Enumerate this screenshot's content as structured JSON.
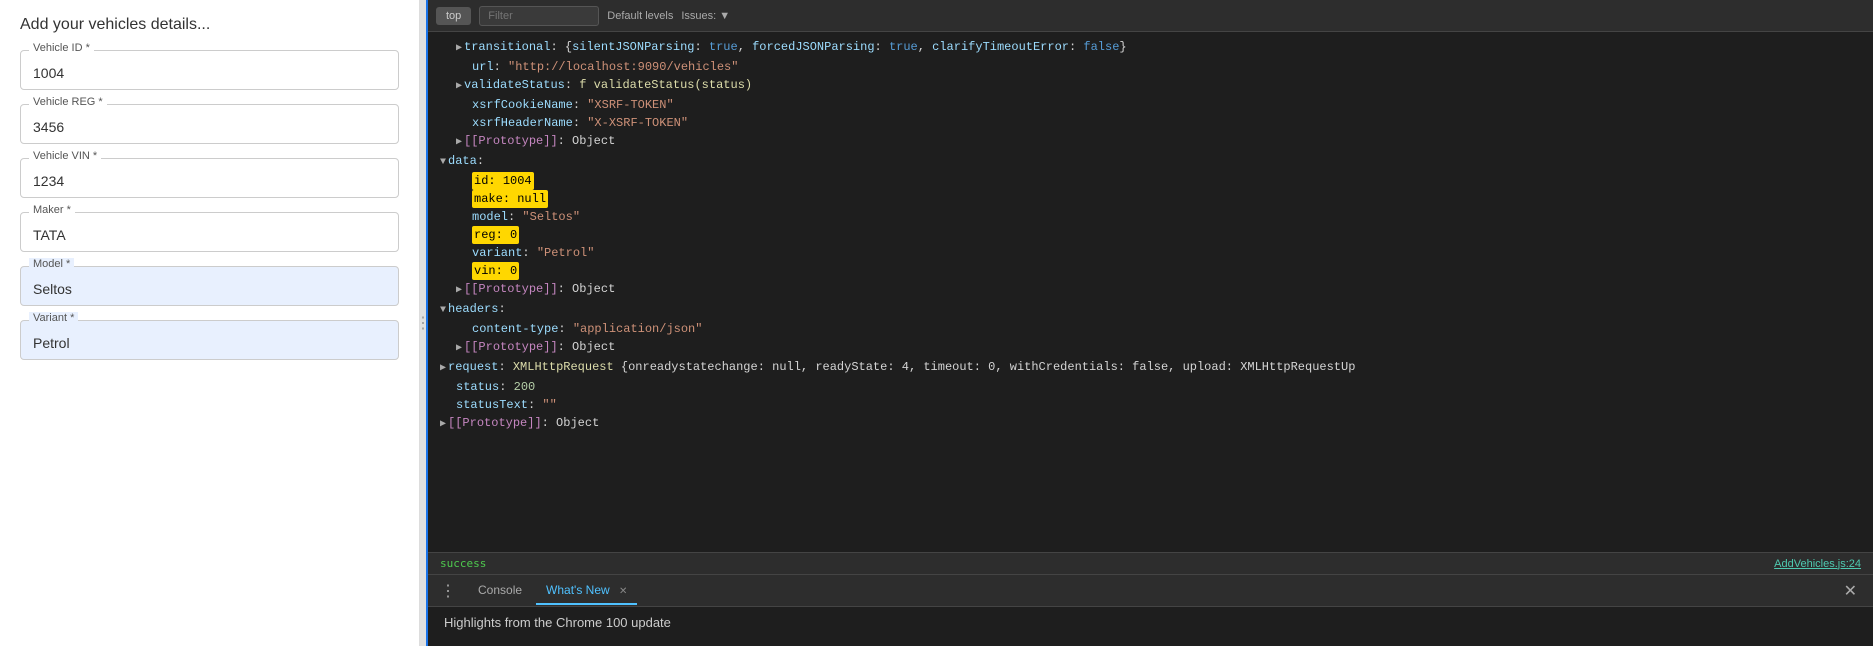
{
  "form": {
    "title": "Add your vehicles details...",
    "fields": [
      {
        "id": "vehicle-id",
        "label": "Vehicle ID",
        "required": true,
        "value": "1004"
      },
      {
        "id": "vehicle-reg",
        "label": "Vehicle REG",
        "required": true,
        "value": "3456"
      },
      {
        "id": "vehicle-vin",
        "label": "Vehicle VIN",
        "required": true,
        "value": "1234"
      },
      {
        "id": "maker",
        "label": "Maker",
        "required": true,
        "value": "TATA"
      },
      {
        "id": "model",
        "label": "Model",
        "required": true,
        "value": "Seltos",
        "highlighted": true
      },
      {
        "id": "variant",
        "label": "Variant",
        "required": true,
        "value": "Petrol",
        "highlighted": true
      }
    ]
  },
  "devtools": {
    "toolbar": {
      "top_btn": "top",
      "filter_placeholder": "Filter",
      "level_label": "Default levels",
      "issues_label": "Issues: ▼"
    },
    "code_lines": [
      {
        "indent": 1,
        "content": "transitional: {silentJSONParsing: true, forcedJSONParsing: true, clarifyTimeoutError: false}"
      },
      {
        "indent": 1,
        "content": "url: \"http://localhost:9090/vehicles\""
      },
      {
        "indent": 1,
        "content": "validateStatus: f validateStatus(status)"
      },
      {
        "indent": 1,
        "content": "xsrfCookieName: \"XSRF-TOKEN\""
      },
      {
        "indent": 1,
        "content": "xsrfHeaderName: \"X-XSRF-TOKEN\""
      },
      {
        "indent": 1,
        "content": "[[Prototype]]: Object"
      },
      {
        "indent": 0,
        "content": "data:",
        "expandable": true,
        "expanded": true
      },
      {
        "indent": 2,
        "content": "id: 1004",
        "highlight": true
      },
      {
        "indent": 2,
        "content": "make: null",
        "highlight": true
      },
      {
        "indent": 2,
        "content": "model: \"Seltos\""
      },
      {
        "indent": 2,
        "content": "reg: 0",
        "highlight": true
      },
      {
        "indent": 2,
        "content": "variant: \"Petrol\""
      },
      {
        "indent": 2,
        "content": "vin: 0",
        "highlight": true
      },
      {
        "indent": 1,
        "content": "[[Prototype]]: Object"
      },
      {
        "indent": 0,
        "content": "headers:",
        "expandable": true,
        "expanded": true
      },
      {
        "indent": 2,
        "content": "content-type: \"application/json\""
      },
      {
        "indent": 1,
        "content": "[[Prototype]]: Object"
      },
      {
        "indent": 0,
        "content": "request: XMLHttpRequest {onreadystatechange: null, readyState: 4, timeout: 0, withCredentials: false, upload: XMLHttpRequestUp"
      },
      {
        "indent": 1,
        "content": "status: 200"
      },
      {
        "indent": 1,
        "content": "statusText: \"\""
      },
      {
        "indent": 0,
        "content": "[[Prototype]]: Object"
      }
    ],
    "status": {
      "text": "success",
      "file_link": "AddVehicles.js:24"
    },
    "tabs": [
      {
        "label": "Console",
        "active": false
      },
      {
        "label": "What's New",
        "active": true,
        "closable": true
      }
    ],
    "whats_new_text": "Highlights from the Chrome 100 update"
  }
}
